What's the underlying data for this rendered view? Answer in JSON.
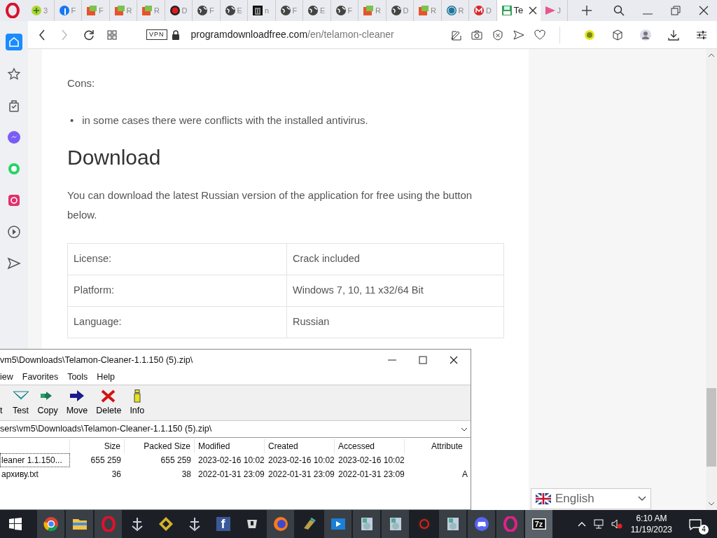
{
  "browser": {
    "tabs": [
      {
        "label": "3",
        "kind": "green",
        "selected": false
      },
      {
        "label": "F",
        "kind": "facebook",
        "selected": false
      },
      {
        "label": "F",
        "kind": "cube",
        "selected": false
      },
      {
        "label": "R",
        "kind": "cube",
        "selected": false
      },
      {
        "label": "R",
        "kind": "cube",
        "selected": false
      },
      {
        "label": "D",
        "kind": "record",
        "selected": false
      },
      {
        "label": "F",
        "kind": "globe",
        "selected": false
      },
      {
        "label": "E",
        "kind": "globe",
        "selected": false
      },
      {
        "label": "n",
        "kind": "museum",
        "selected": false
      },
      {
        "label": "F",
        "kind": "globe",
        "selected": false
      },
      {
        "label": "E",
        "kind": "globe",
        "selected": false
      },
      {
        "label": "F",
        "kind": "globe",
        "selected": false
      },
      {
        "label": "R",
        "kind": "cube",
        "selected": false
      },
      {
        "label": "D",
        "kind": "globe",
        "selected": false
      },
      {
        "label": "R",
        "kind": "cube",
        "selected": false
      },
      {
        "label": "R",
        "kind": "wordpress",
        "selected": false
      },
      {
        "label": "D",
        "kind": "mega",
        "selected": false
      },
      {
        "label": "Te",
        "kind": "floppy",
        "selected": true
      },
      {
        "label": "J",
        "kind": "ds",
        "selected": false
      }
    ],
    "vpn": "VPN",
    "domain": "programdownloadfree.com",
    "path": "/en/telamon-cleaner",
    "sidebar": [
      {
        "kind": "home",
        "selected": true
      },
      {
        "kind": "star",
        "selected": false
      },
      {
        "kind": "bag",
        "selected": false
      },
      {
        "kind": "messenger",
        "selected": false
      },
      {
        "kind": "whatsapp",
        "selected": false
      },
      {
        "kind": "instagram",
        "selected": false
      },
      {
        "kind": "play",
        "selected": false
      },
      {
        "kind": "send",
        "selected": false
      }
    ]
  },
  "article": {
    "cons_label": "Cons:",
    "cons": [
      {
        "marker": "•",
        "text": "in some cases there were conflicts with the installed antivirus."
      }
    ],
    "heading": "Download",
    "paragraph": "You can download the latest Russian version of the application for free using the button below.",
    "specs": [
      {
        "label": "License:",
        "value": "Crack included"
      },
      {
        "label": "Platform:",
        "value": "Windows 7, 10, 11 x32/64 Bit"
      },
      {
        "label": "Language:",
        "value": "Russian"
      }
    ]
  },
  "language_selector": {
    "value": "English"
  },
  "archive_window": {
    "title": "vm5\\Downloads\\Telamon-Cleaner-1.1.150 (5).zip\\",
    "menu": [
      "iew",
      "Favorites",
      "Tools",
      "Help"
    ],
    "toolbar": [
      {
        "label": "t",
        "kind": "cut"
      },
      {
        "label": "Test",
        "kind": "test"
      },
      {
        "label": "Copy",
        "kind": "copy"
      },
      {
        "label": "Move",
        "kind": "move"
      },
      {
        "label": "Delete",
        "kind": "delete"
      },
      {
        "label": "Info",
        "kind": "info"
      }
    ],
    "path": "sers\\vm5\\Downloads\\Telamon-Cleaner-1.1.150 (5).zip\\",
    "columns": [
      "",
      "Size",
      "Packed Size",
      "Modified",
      "Created",
      "Accessed",
      "Attribute"
    ],
    "rows": [
      {
        "selected": true,
        "cells": [
          "leaner 1.1.150...",
          "655 259",
          "655 259",
          "2023-02-16 10:02",
          "2023-02-16 10:02",
          "2023-02-16 10:02"
        ]
      },
      {
        "selected": false,
        "cells": [
          "архиву.txt",
          "36",
          "38",
          "2022-01-31 23:09",
          "2022-01-31 23:09",
          "2022-01-31 23:09",
          "A"
        ]
      }
    ]
  },
  "taskbar": {
    "apps": [
      {
        "kind": "chrome",
        "running": true
      },
      {
        "kind": "folder",
        "running": true
      },
      {
        "kind": "opera",
        "running": true
      },
      {
        "kind": "ship",
        "running": false
      },
      {
        "kind": "diamond",
        "running": false
      },
      {
        "kind": "ship",
        "running": false
      },
      {
        "kind": "facebook",
        "glyph": "f",
        "running": false
      },
      {
        "kind": "tank",
        "running": false
      },
      {
        "kind": "firefox",
        "running": true
      },
      {
        "kind": "tool",
        "running": false
      },
      {
        "kind": "video",
        "running": true
      },
      {
        "kind": "installer",
        "running": true
      },
      {
        "kind": "installer",
        "running": true
      },
      {
        "kind": "redcircle",
        "running": false
      },
      {
        "kind": "installer",
        "running": true
      },
      {
        "kind": "discord",
        "running": true
      },
      {
        "kind": "opera-gx",
        "running": true
      },
      {
        "kind": "sevenzip",
        "glyph": "7z",
        "selected": true
      }
    ],
    "time": "6:10 AM",
    "date": "11/19/2023",
    "notifications": "4"
  }
}
